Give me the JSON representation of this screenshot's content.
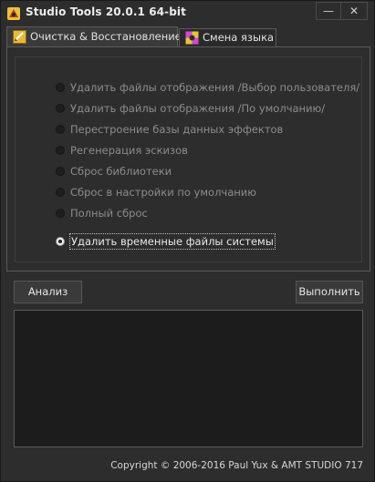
{
  "window": {
    "title": "Studio Tools 20.0.1  64-bit",
    "minimize_glyph": "—",
    "close_glyph": "✕",
    "app_icon": "studio-tools-app-icon"
  },
  "tabs": [
    {
      "label": "Очистка & Восстановление",
      "active": true,
      "icon": "cleanup-icon"
    },
    {
      "label": "Смена языка",
      "active": false,
      "icon": "language-icon"
    }
  ],
  "options": [
    {
      "label": "Удалить файлы отображения /Выбор пользователя/",
      "selected": false
    },
    {
      "label": "Удалить файлы отображения /По умолчанию/",
      "selected": false
    },
    {
      "label": "Перестроение базы данных эффектов",
      "selected": false
    },
    {
      "label": "Регенерация эскизов",
      "selected": false
    },
    {
      "label": "Сброс библиотеки",
      "selected": false
    },
    {
      "label": "Сброс в настройки по умолчанию",
      "selected": false
    },
    {
      "label": "Полный сброс",
      "selected": false
    },
    {
      "label": "Удалить временные файлы системы",
      "selected": true
    }
  ],
  "buttons": {
    "analyze_label": "Анализ",
    "run_label": "Выполнить"
  },
  "footer": {
    "copyright": "Copyright © 2006-2016 Paul Yux & AMT STUDIO 717"
  },
  "colors": {
    "background": "#2d2d2d",
    "log_background": "#1c1c1c",
    "border": "#5a5a5a"
  }
}
